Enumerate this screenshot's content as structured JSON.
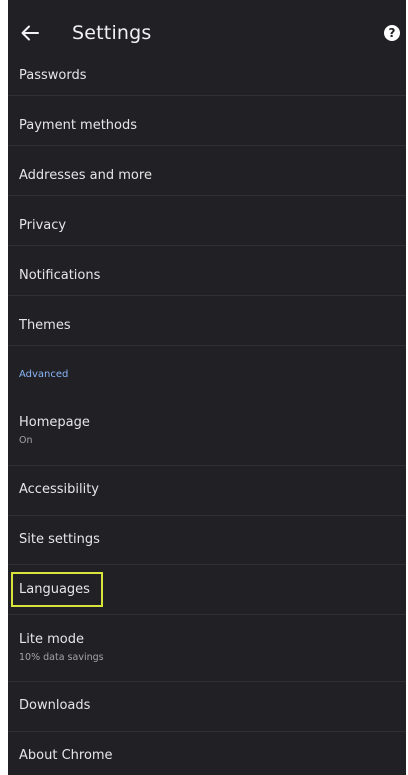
{
  "header": {
    "title": "Settings",
    "back_icon": "arrow-left-icon",
    "help_icon": "help-circle-icon",
    "help_glyph": "?"
  },
  "items": {
    "passwords": {
      "label": "Passwords"
    },
    "payment_methods": {
      "label": "Payment methods"
    },
    "addresses": {
      "label": "Addresses and more"
    },
    "privacy": {
      "label": "Privacy"
    },
    "notifications": {
      "label": "Notifications"
    },
    "themes": {
      "label": "Themes"
    },
    "homepage": {
      "label": "Homepage",
      "sub": "On"
    },
    "accessibility": {
      "label": "Accessibility"
    },
    "site_settings": {
      "label": "Site settings"
    },
    "languages": {
      "label": "Languages",
      "highlighted": true
    },
    "lite_mode": {
      "label": "Lite mode",
      "sub": "10% data savings"
    },
    "downloads": {
      "label": "Downloads"
    },
    "about_chrome": {
      "label": "About Chrome"
    }
  },
  "sections": {
    "advanced": "Advanced"
  },
  "colors": {
    "background": "#212125",
    "text": "#e6e6e8",
    "secondary_text": "#a4a4a8",
    "accent": "#8ab4f8",
    "highlight_border": "#d8e43c"
  }
}
